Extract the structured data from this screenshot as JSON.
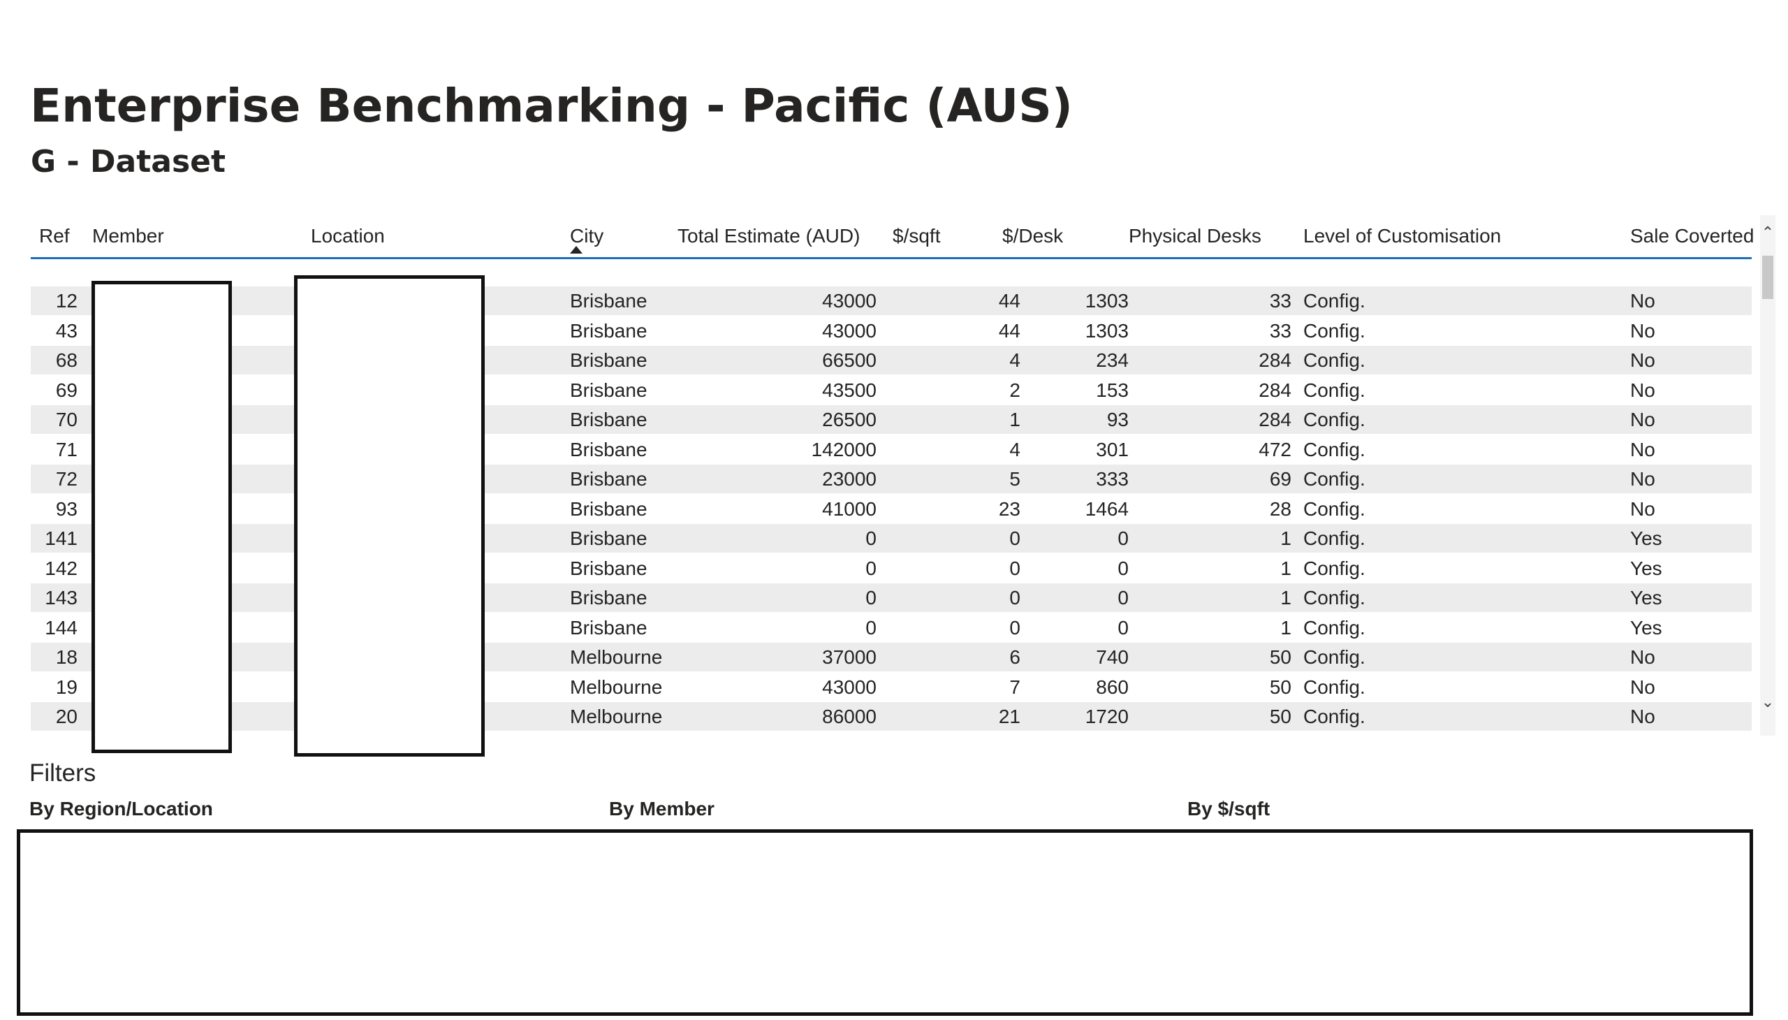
{
  "report": {
    "title": "Enterprise Benchmarking - Pacific (AUS)",
    "subtitle": "G - Dataset"
  },
  "table": {
    "sort_column": "City",
    "sort_direction": "ascending",
    "headers": {
      "ref": "Ref",
      "member": "Member",
      "location": "Location",
      "city": "City",
      "total": "Total Estimate (AUD)",
      "sqft": "$/sqft",
      "desk": "$/Desk",
      "desks": "Physical Desks",
      "custom": "Level of Customisation",
      "sale": "Sale Coverted"
    },
    "rows": [
      {
        "ref": "12",
        "city": "Brisbane",
        "total": "43000",
        "sqft": "44",
        "desk": "1303",
        "desks": "33",
        "custom": "Config.",
        "sale": "No"
      },
      {
        "ref": "43",
        "city": "Brisbane",
        "total": "43000",
        "sqft": "44",
        "desk": "1303",
        "desks": "33",
        "custom": "Config.",
        "sale": "No"
      },
      {
        "ref": "68",
        "city": "Brisbane",
        "total": "66500",
        "sqft": "4",
        "desk": "234",
        "desks": "284",
        "custom": "Config.",
        "sale": "No"
      },
      {
        "ref": "69",
        "city": "Brisbane",
        "total": "43500",
        "sqft": "2",
        "desk": "153",
        "desks": "284",
        "custom": "Config.",
        "sale": "No"
      },
      {
        "ref": "70",
        "city": "Brisbane",
        "total": "26500",
        "sqft": "1",
        "desk": "93",
        "desks": "284",
        "custom": "Config.",
        "sale": "No"
      },
      {
        "ref": "71",
        "city": "Brisbane",
        "total": "142000",
        "sqft": "4",
        "desk": "301",
        "desks": "472",
        "custom": "Config.",
        "sale": "No"
      },
      {
        "ref": "72",
        "city": "Brisbane",
        "total": "23000",
        "sqft": "5",
        "desk": "333",
        "desks": "69",
        "custom": "Config.",
        "sale": "No"
      },
      {
        "ref": "93",
        "city": "Brisbane",
        "total": "41000",
        "sqft": "23",
        "desk": "1464",
        "desks": "28",
        "custom": "Config.",
        "sale": "No"
      },
      {
        "ref": "141",
        "city": "Brisbane",
        "total": "0",
        "sqft": "0",
        "desk": "0",
        "desks": "1",
        "custom": "Config.",
        "sale": "Yes"
      },
      {
        "ref": "142",
        "city": "Brisbane",
        "total": "0",
        "sqft": "0",
        "desk": "0",
        "desks": "1",
        "custom": "Config.",
        "sale": "Yes"
      },
      {
        "ref": "143",
        "city": "Brisbane",
        "total": "0",
        "sqft": "0",
        "desk": "0",
        "desks": "1",
        "custom": "Config.",
        "sale": "Yes"
      },
      {
        "ref": "144",
        "city": "Brisbane",
        "total": "0",
        "sqft": "0",
        "desk": "0",
        "desks": "1",
        "custom": "Config.",
        "sale": "Yes"
      },
      {
        "ref": "18",
        "city": "Melbourne",
        "total": "37000",
        "sqft": "6",
        "desk": "740",
        "desks": "50",
        "custom": "Config.",
        "sale": "No"
      },
      {
        "ref": "19",
        "city": "Melbourne",
        "total": "43000",
        "sqft": "7",
        "desk": "860",
        "desks": "50",
        "custom": "Config.",
        "sale": "No"
      },
      {
        "ref": "20",
        "city": "Melbourne",
        "total": "86000",
        "sqft": "21",
        "desk": "1720",
        "desks": "50",
        "custom": "Config.",
        "sale": "No"
      }
    ]
  },
  "filters": {
    "heading": "Filters",
    "region_label": "By Region/Location",
    "member_label": "By Member",
    "sqft_label": "By $/sqft"
  },
  "icons": {
    "sort": "sort-ascending-icon",
    "scroll_up": "chevron-up-icon",
    "scroll_down": "chevron-down-icon"
  }
}
